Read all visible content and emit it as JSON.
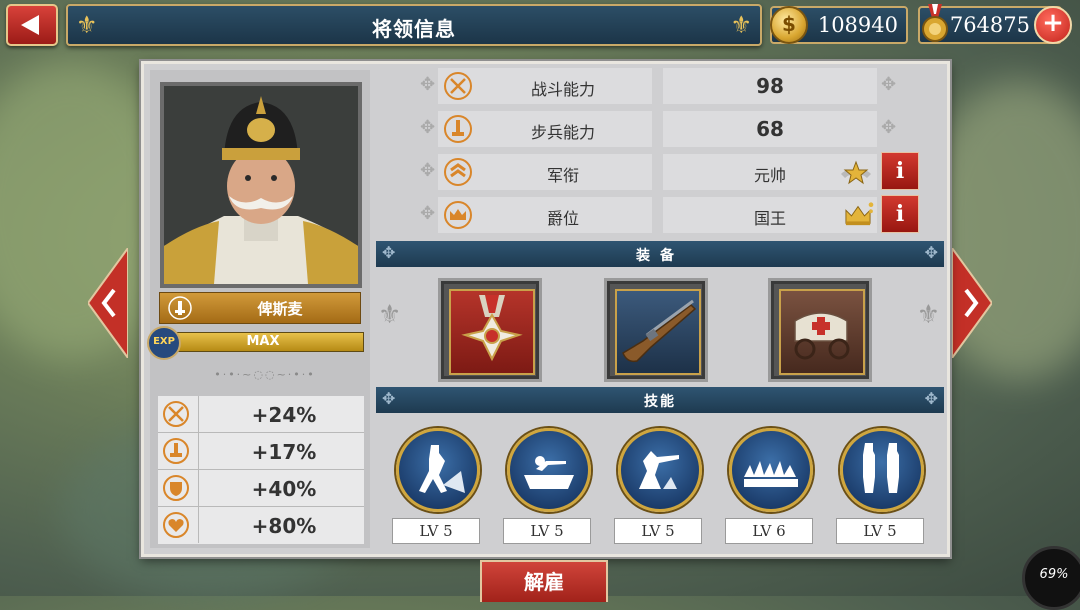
{
  "header": {
    "title": "将领信息",
    "gold": "108940",
    "medals": "764875"
  },
  "general": {
    "name": "俾斯麦",
    "exp_badge": "EXP",
    "exp_text": "MAX",
    "bonuses": [
      "+24%",
      "+17%",
      "+40%",
      "+80%"
    ]
  },
  "stats": [
    {
      "label": "战斗能力",
      "value": "98"
    },
    {
      "label": "步兵能力",
      "value": "68"
    },
    {
      "label": "军衔",
      "value": "元帅"
    },
    {
      "label": "爵位",
      "value": "国王"
    }
  ],
  "info_label": "i",
  "equipment": {
    "title": "装备",
    "items": [
      "medal-icon",
      "musket-icon",
      "ambulance-wagon-icon"
    ]
  },
  "skills": {
    "title": "技能",
    "levels": [
      "LV 5",
      "LV 5",
      "LV 5",
      "LV 6",
      "LV 5"
    ]
  },
  "dismiss_label": "解雇",
  "gauge_value": "69%",
  "colors": {
    "accent_red": "#b8261e",
    "navy": "#1e3a50",
    "gold": "#c9a968"
  }
}
